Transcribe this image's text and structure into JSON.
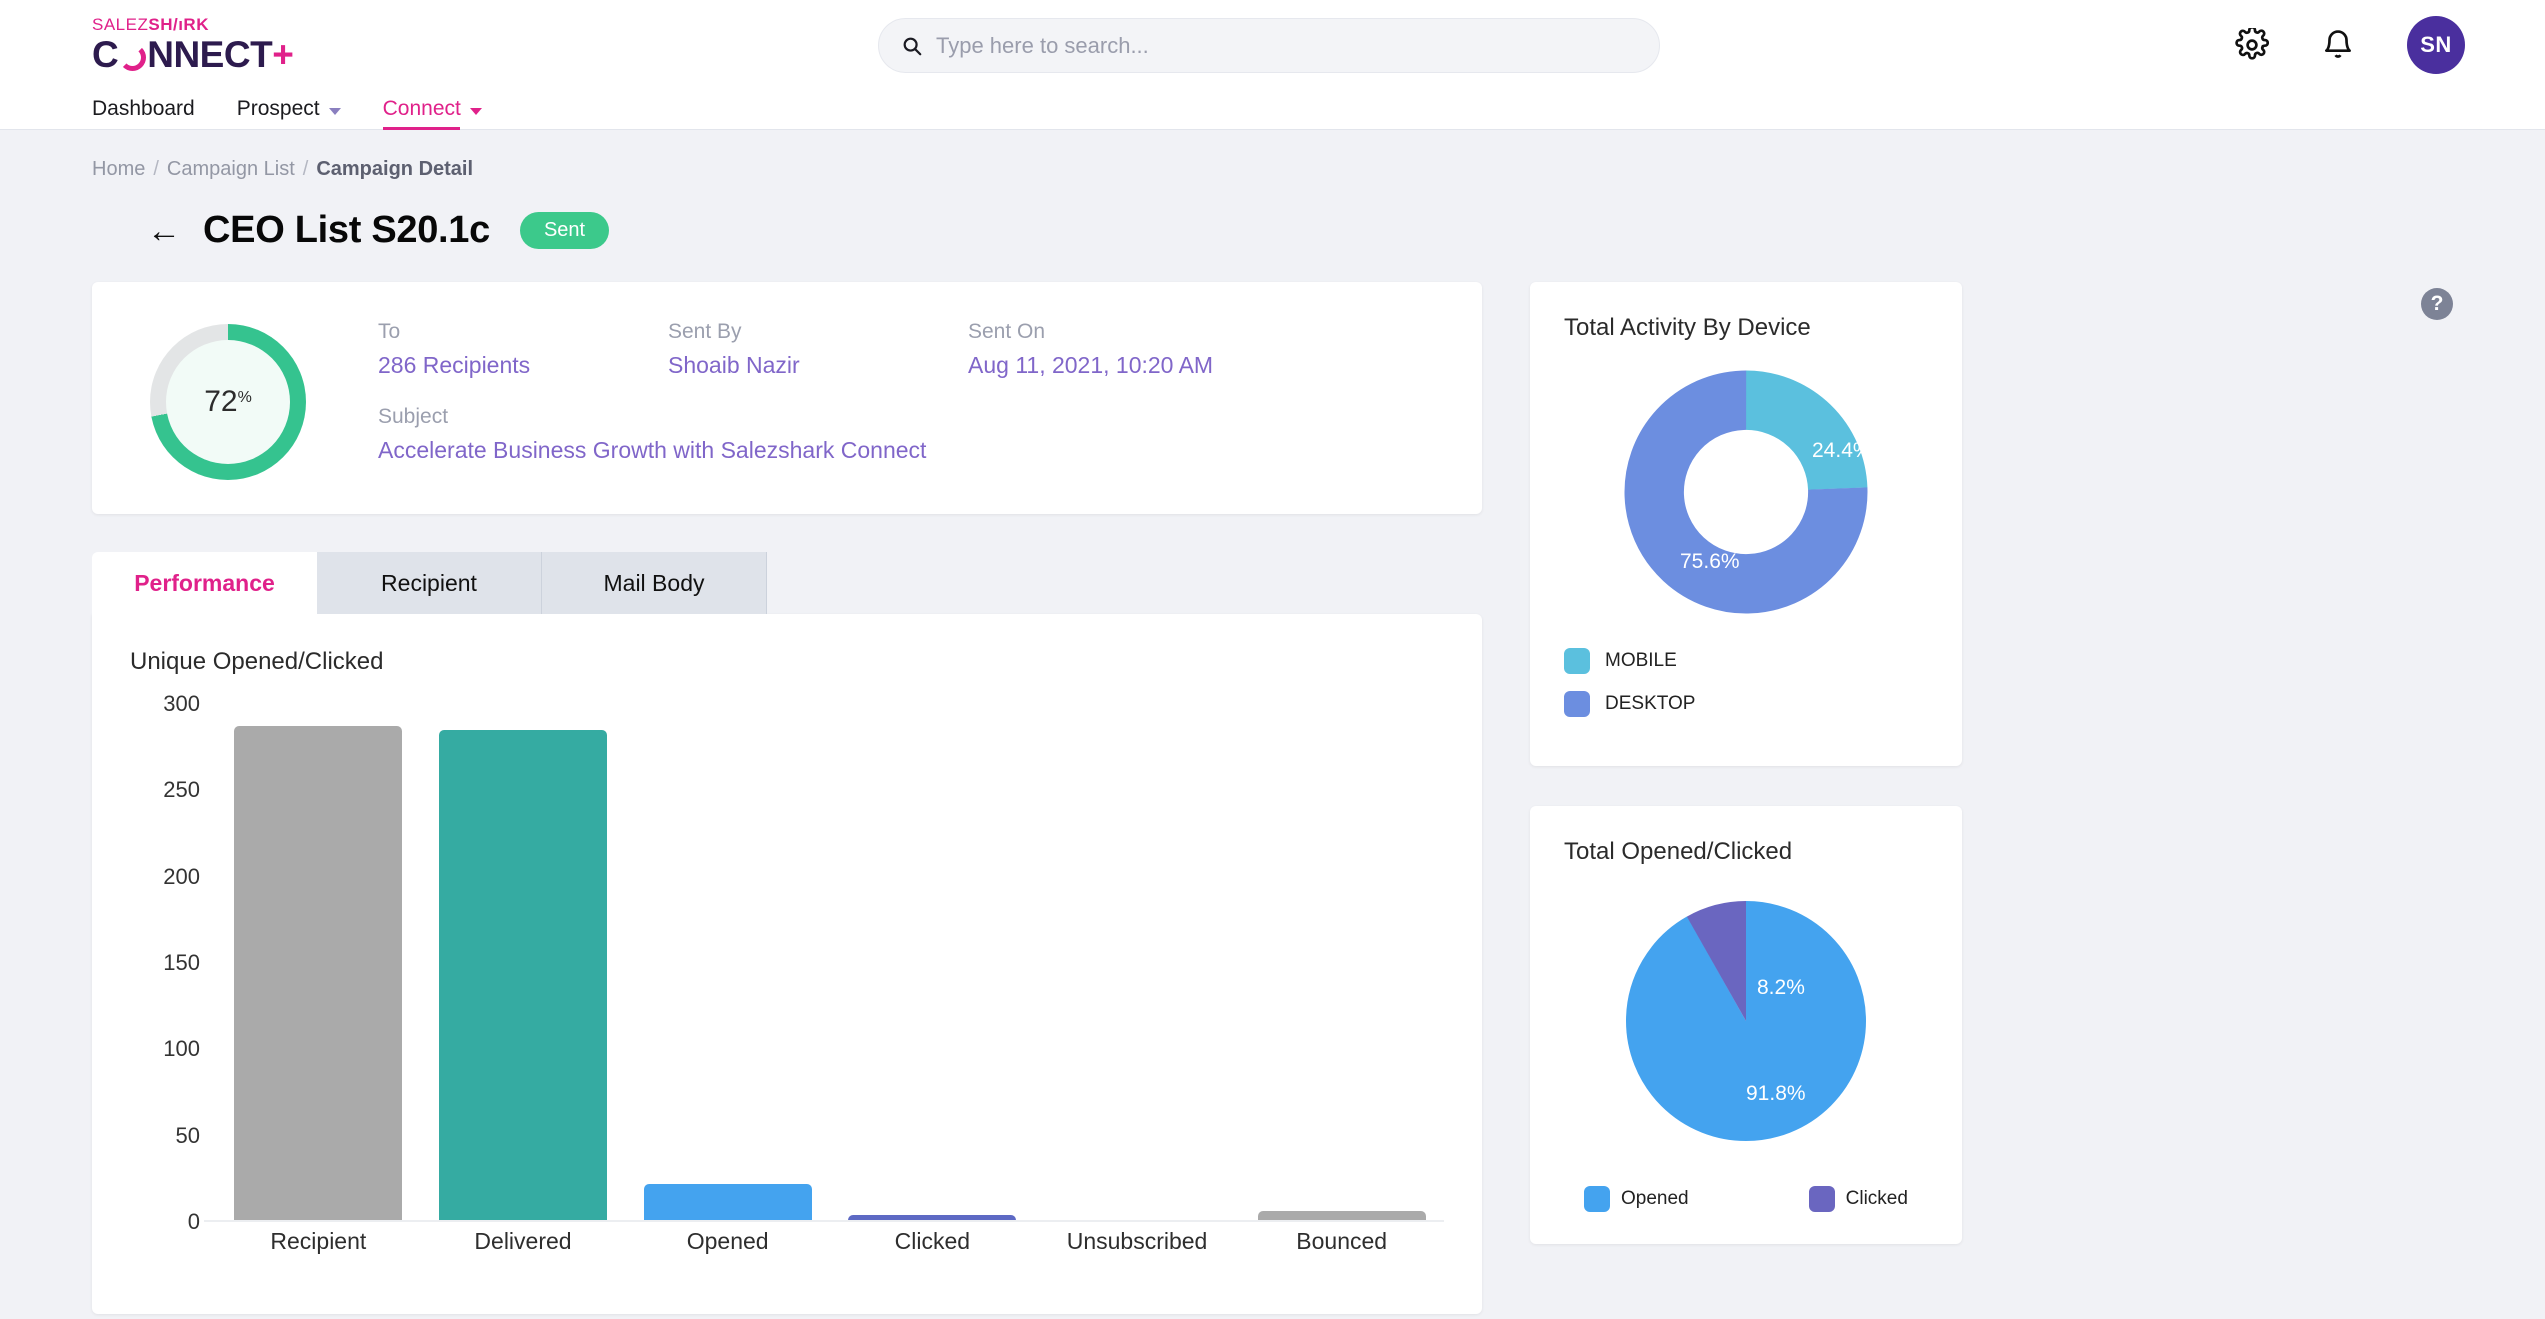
{
  "brand": {
    "logo_top_light": "SALEZ",
    "logo_top_bold": "SH/ıRK",
    "logo_main_c": "C",
    "logo_main_rest": "NNECT",
    "logo_main_plus": "+",
    "accent": "#e0218a"
  },
  "search": {
    "placeholder": "Type here to search...",
    "value": ""
  },
  "topbar": {
    "settings_icon": "gear-icon",
    "notifications_icon": "bell-icon",
    "avatar_initials": "SN"
  },
  "nav": {
    "items": [
      {
        "label": "Dashboard",
        "has_caret": false,
        "active": false
      },
      {
        "label": "Prospect",
        "has_caret": true,
        "active": false
      },
      {
        "label": "Connect",
        "has_caret": true,
        "active": true
      }
    ]
  },
  "breadcrumb": {
    "items": [
      "Home",
      "Campaign List",
      "Campaign Detail"
    ],
    "separator": "/"
  },
  "help": {
    "glyph": "?"
  },
  "header": {
    "back_icon": "arrow-left-icon",
    "title": "CEO List S20.1c",
    "status_badge": "Sent",
    "badge_color": "#3cc98b"
  },
  "summary": {
    "percent_value": "72",
    "percent_suffix": "%",
    "percent_number": 72,
    "fields": [
      {
        "label": "To",
        "value": "286 Recipients"
      },
      {
        "label": "Sent By",
        "value": "Shoaib Nazir"
      },
      {
        "label": "Sent On",
        "value": "Aug 11, 2021, 10:20 AM"
      },
      {
        "label": "Subject",
        "value": "Accelerate Business Growth with Salezshark Connect"
      }
    ]
  },
  "tabs": [
    {
      "label": "Performance",
      "active": true
    },
    {
      "label": "Recipient",
      "active": false
    },
    {
      "label": "Mail Body",
      "active": false
    }
  ],
  "chart_data": [
    {
      "type": "bar",
      "title": "Unique Opened/Clicked",
      "xlabel": "",
      "ylabel": "",
      "ylim": [
        0,
        300
      ],
      "yticks": [
        300,
        250,
        200,
        150,
        100,
        50,
        0
      ],
      "grid": false,
      "categories": [
        "Recipient",
        "Delivered",
        "Opened",
        "Clicked",
        "Unsubscribed",
        "Bounced"
      ],
      "values": [
        286,
        284,
        21,
        3,
        0,
        5
      ],
      "colors": [
        "#aaaaaa",
        "#35aba2",
        "#44a3ef",
        "#5d69c4",
        "#aaaaaa",
        "#aaaaaa"
      ]
    },
    {
      "type": "pie",
      "title": "Total Activity By Device",
      "variant": "donut",
      "legend_position": "bottom",
      "labels": [
        "MOBILE",
        "DESKTOP"
      ],
      "values": [
        24.4,
        75.6
      ],
      "value_labels": [
        "24.4%",
        "75.6%"
      ],
      "colors": [
        "#5bc0de",
        "#6c8ee0"
      ]
    },
    {
      "type": "pie",
      "title": "Total Opened/Clicked",
      "variant": "pie",
      "legend_position": "bottom",
      "labels": [
        "Opened",
        "Clicked"
      ],
      "values": [
        91.8,
        8.2
      ],
      "value_labels": [
        "91.8%",
        "8.2%"
      ],
      "colors": [
        "#44a3ef",
        "#6a66c0"
      ]
    }
  ]
}
